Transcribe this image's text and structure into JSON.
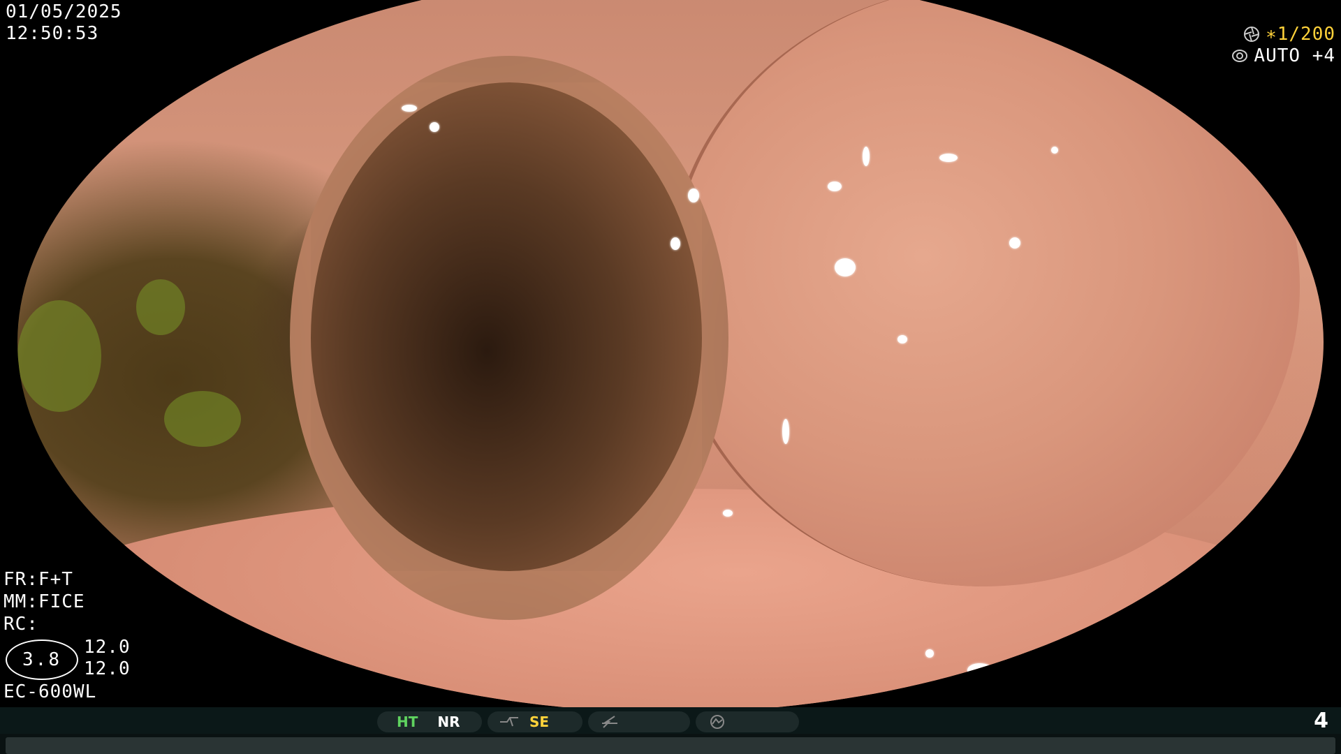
{
  "overlay": {
    "date": "01/05/2025",
    "time": "12:50:53",
    "shutter": "∗1/200",
    "iris": "AUTO +4",
    "fr": "FR:F+T",
    "mm": "MM:FICE",
    "rc": "RC:",
    "color_enhance": "3.8",
    "ce_top": "12.0",
    "ce_bottom": "12.0",
    "scope_model": "EC-600WL"
  },
  "status_bar": {
    "ht_label": "HT",
    "nr_label": "NR",
    "se_label": "SE",
    "frame_number": "4"
  },
  "colors": {
    "accent_yellow": "#ffd23a",
    "ht_green": "#5fd35f",
    "bar_bg": "#0b1818"
  },
  "icons": [
    "shutter-icon",
    "iris-icon",
    "structure-icon",
    "flash-icon",
    "brightness-icon"
  ]
}
